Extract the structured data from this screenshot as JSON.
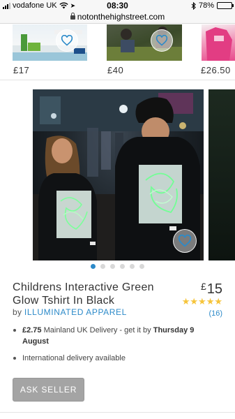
{
  "status_bar": {
    "carrier": "vodafone UK",
    "time": "08:30",
    "battery": "78%",
    "battery_level": 0.78,
    "icons": [
      "signal-icon",
      "wifi-icon",
      "bluetooth-icon",
      "battery-icon"
    ]
  },
  "url_bar": {
    "url": "notonthehighstreet.com"
  },
  "thumbnails": [
    {
      "price": "£17"
    },
    {
      "price": "£40"
    },
    {
      "price": "£26.50"
    }
  ],
  "carousel": {
    "dot_count": 6,
    "active_index": 0
  },
  "product": {
    "title": "Childrens Interactive Green Glow Tshirt In Black",
    "price_currency": "£",
    "price_value": "15",
    "rating": 5,
    "review_count": "(16)",
    "by_label": "by",
    "seller": "ILLUMINATED APPAREL",
    "delivery": {
      "amount": "£2.75",
      "text": "Mainland UK Delivery - get it by",
      "date": "Thursday 9 August"
    },
    "international": "International delivery available",
    "ask_seller_label": "ASK SELLER"
  },
  "colors": {
    "accent": "#2c8ac9",
    "star": "#f6c43a",
    "button": "#a4a4a4"
  }
}
